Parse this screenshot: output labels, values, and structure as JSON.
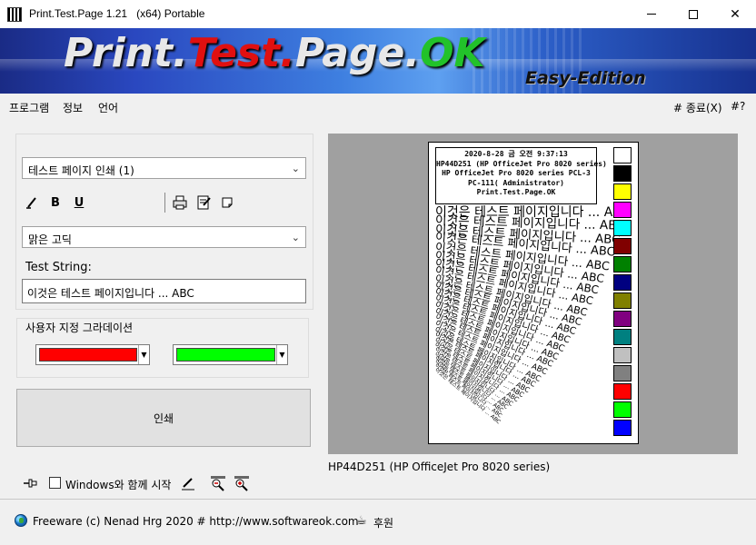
{
  "window": {
    "title": "Print.Test.Page 1.21   (x64) Portable",
    "minimize_glyph": "",
    "close_glyph": "✕"
  },
  "banner": {
    "logo_part1": "Print.",
    "logo_part2": "Test.",
    "logo_part3": "Page.",
    "logo_part4": "OK",
    "subtitle": "Easy-Edition"
  },
  "menu": {
    "items": [
      {
        "label": "프로그램"
      },
      {
        "label": "정보"
      },
      {
        "label": "언어"
      }
    ],
    "exit_label": "# 종료(X)",
    "help_label": "#?"
  },
  "left_panel": {
    "print_mode": {
      "value": "테스트 페이지 인쇄 (1)"
    },
    "toolbar": {
      "italic_glyph": "𝘐",
      "bold_glyph": "B",
      "underline_glyph": "U"
    },
    "font": {
      "value": "맑은 고딕"
    },
    "test_string_label": "Test String:",
    "test_string_value": "이것은 테스트 페이지입니다 ... ABC",
    "gradient_legend": "사용자 지정 그라데이션",
    "gradient_color1": "#ff0000",
    "gradient_color2": "#00ff00",
    "print_button": "인쇄",
    "startup_label": "Windows와 함께 시작",
    "startup_checked": false
  },
  "preview": {
    "info_lines": [
      "2020-8-28 금 오전 9:37:13",
      "HP44D251 (HP OfficeJet Pro 8020 series)",
      "HP OfficeJet Pro 8020 series PCL-3",
      "PC-111( Administrator)",
      "Print.Test.Page.OK"
    ],
    "sample_line": "이것은 테스트 페이지입니다 ... ABC",
    "palette": [
      "#ffffff",
      "#000000",
      "#ffff00",
      "#ff00ff",
      "#00ffff",
      "#800000",
      "#008000",
      "#000080",
      "#808000",
      "#800080",
      "#008080",
      "#c0c0c0",
      "#808080",
      "#ff0000",
      "#00ff00",
      "#0000ff"
    ],
    "printer_caption": "HP44D251 (HP OfficeJet Pro 8020 series)"
  },
  "status_bar": {
    "text": "Freeware (c) Nenad Hrg 2020 # http://www.softwareok.com",
    "donate_label": "후원"
  }
}
